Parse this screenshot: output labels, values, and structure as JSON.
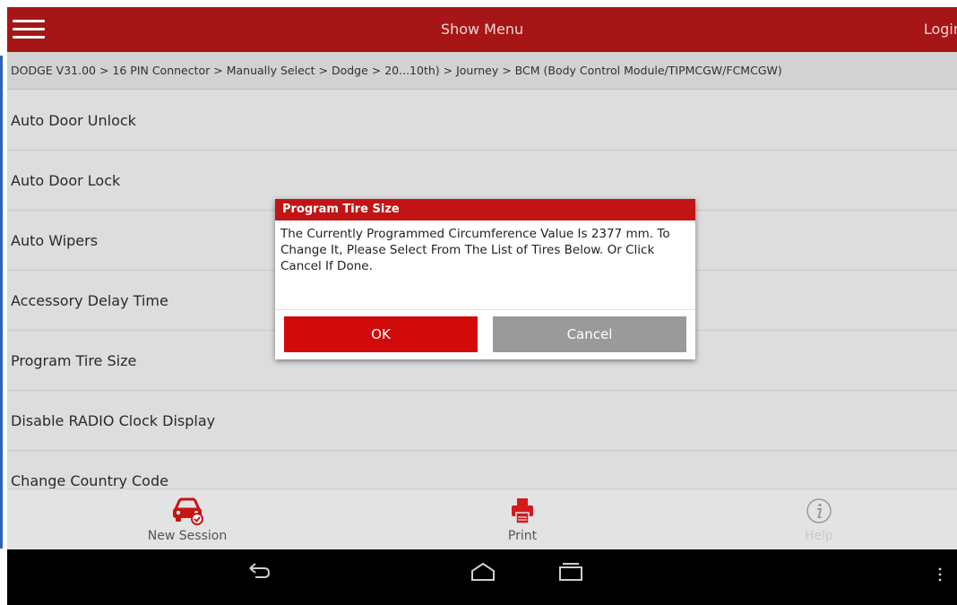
{
  "topbar": {
    "menu_icon": "hamburger-icon",
    "title": "Show Menu",
    "login_label": "Login"
  },
  "breadcrumb": {
    "path": "DODGE V31.00 > 16 PIN Connector > Manually Select > Dodge > 20...10th) > Journey > BCM (Body Control Module/TIPMCGW/FCMCGW)"
  },
  "functions": [
    {
      "label": "Auto Door Unlock"
    },
    {
      "label": "Auto Door Lock"
    },
    {
      "label": "Auto Wipers"
    },
    {
      "label": "Accessory Delay Time"
    },
    {
      "label": "Program Tire Size"
    },
    {
      "label": "Disable RADIO Clock Display"
    },
    {
      "label": "Change Country Code"
    }
  ],
  "dialog": {
    "title": "Program Tire Size",
    "message": "The Currently Programmed Circumference Value Is 2377 mm. To Change It, Please Select From The List of Tires Below. Or Click Cancel If Done.",
    "ok_label": "OK",
    "cancel_label": "Cancel"
  },
  "toolbar": {
    "new_session_label": "New Session",
    "new_session_icon": "car-check-icon",
    "print_label": "Print",
    "print_icon": "printer-icon",
    "help_label": "Help",
    "help_icon": "info-icon"
  },
  "navbar": {
    "back_icon": "back-icon",
    "home_icon": "home-icon",
    "recents_icon": "recent-apps-icon",
    "overflow_icon": "overflow-menu-icon"
  },
  "colors": {
    "brand_red": "#a61616",
    "dialog_red": "#c21414",
    "ok_red": "#d10a0a",
    "cancel_gray": "#9a9a9a"
  }
}
